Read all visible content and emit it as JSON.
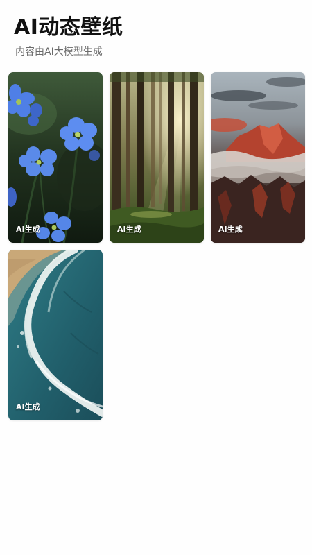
{
  "header": {
    "title": "AI动态壁纸",
    "subtitle": "内容由AI大模型生成"
  },
  "wallpapers": [
    {
      "scene": "blue-flowers",
      "badge": "AI生成"
    },
    {
      "scene": "sunlit-forest",
      "badge": "AI生成"
    },
    {
      "scene": "red-mountain-clouds",
      "badge": "AI生成"
    },
    {
      "scene": "ocean-waves-beach",
      "badge": "AI生成"
    }
  ],
  "colors": {
    "background": "#fefefe",
    "title": "#111111",
    "subtitle": "#6b6b6b",
    "badge_text": "#ffffff"
  }
}
